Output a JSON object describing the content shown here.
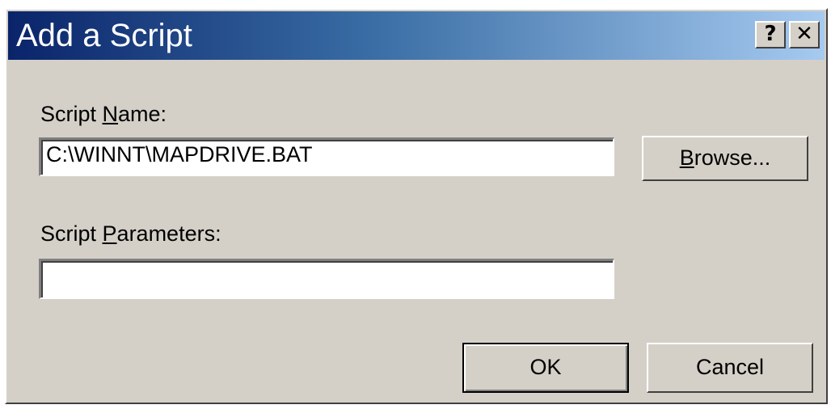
{
  "window": {
    "title": "Add a Script",
    "help_label": "?",
    "close_label": "✕"
  },
  "form": {
    "script_name_label_pre": "Script ",
    "script_name_label_accel": "N",
    "script_name_label_post": "ame:",
    "script_name_value": "C:\\WINNT\\MAPDRIVE.BAT",
    "script_params_label_pre": "Script ",
    "script_params_label_accel": "P",
    "script_params_label_post": "arameters:",
    "script_params_value": ""
  },
  "buttons": {
    "browse_accel": "B",
    "browse_rest": "rowse...",
    "ok_label": "OK",
    "cancel_label": "Cancel"
  },
  "colors": {
    "title_start": "#0a246a",
    "title_end": "#a6caf0",
    "face": "#d4d0c8"
  }
}
